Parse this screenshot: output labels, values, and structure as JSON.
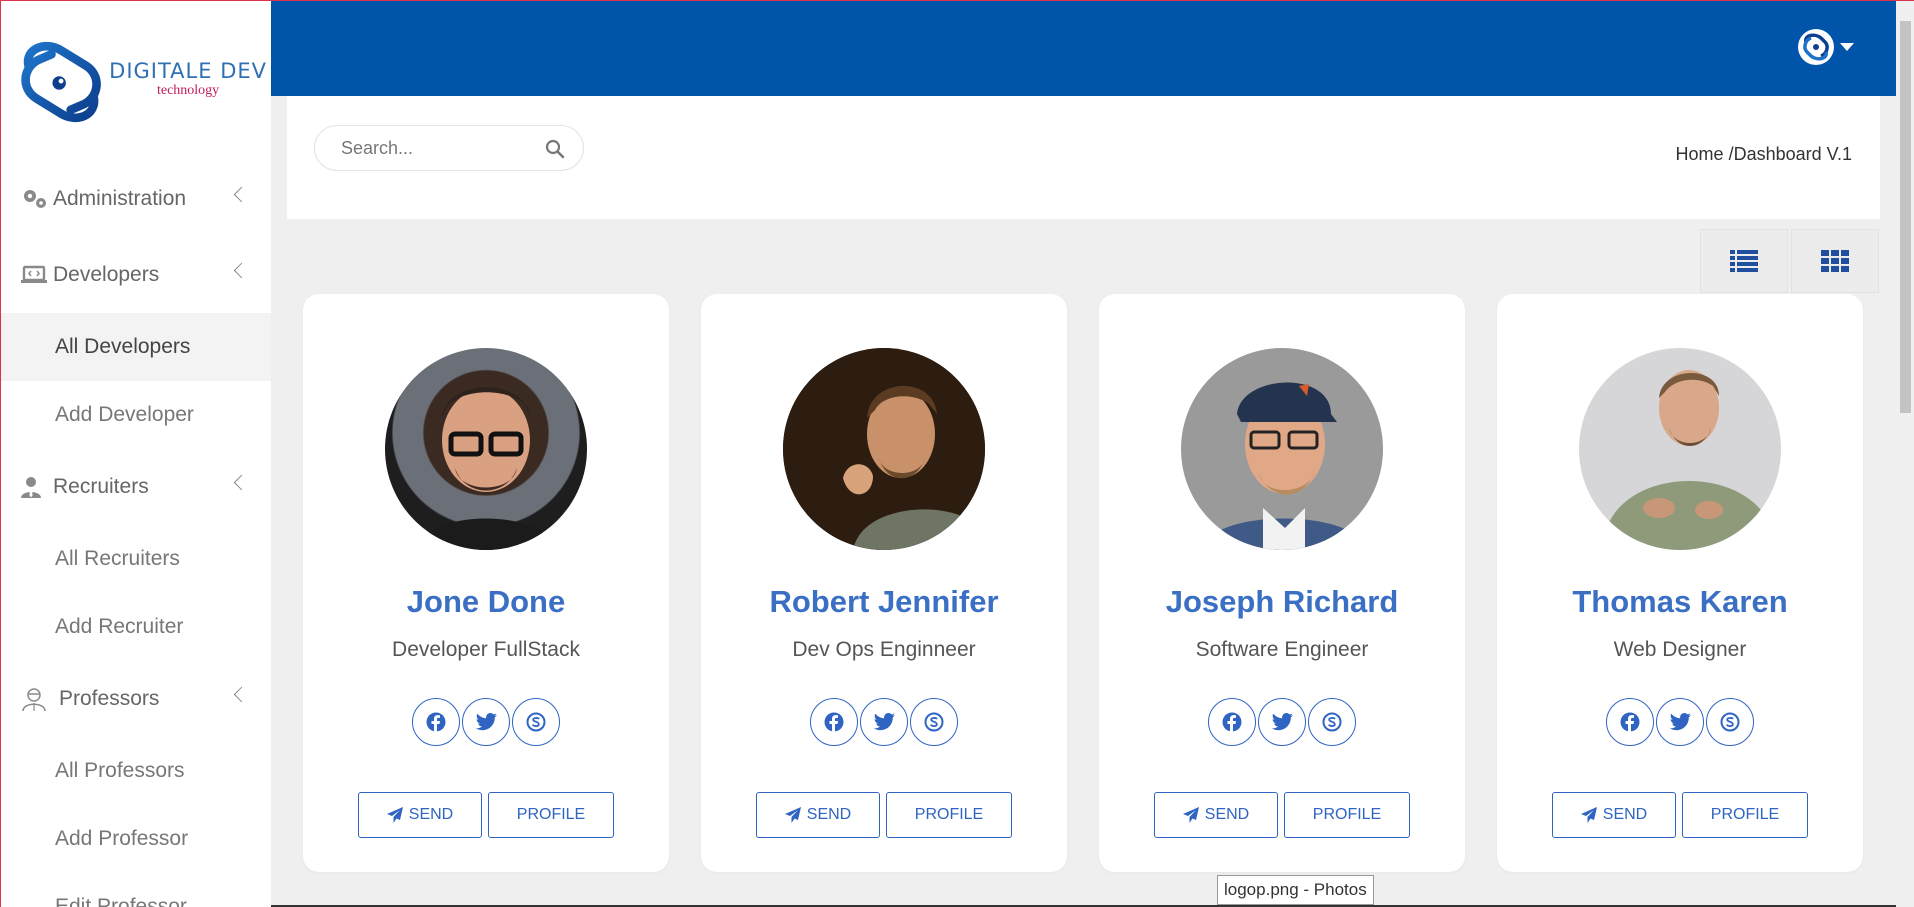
{
  "brand": {
    "title": "DIGITALE DEV",
    "subtitle": "technology"
  },
  "sidebar": {
    "groups": [
      {
        "label": "Administration",
        "icon": "gears-icon"
      },
      {
        "label": "Developers",
        "icon": "laptop-code-icon",
        "items": [
          "All Developers",
          "Add Developer"
        ],
        "active": "All Developers"
      },
      {
        "label": "Recruiters",
        "icon": "user-tie-icon",
        "items": [
          "All Recruiters",
          "Add Recruiter"
        ]
      },
      {
        "label": "Professors",
        "icon": "professor-icon",
        "items": [
          "All Professors",
          "Add Professor",
          "Edit Professor"
        ]
      }
    ]
  },
  "search": {
    "placeholder": "Search..."
  },
  "breadcrumb": "Home /Dashboard V.1",
  "cards": [
    {
      "name": "Jone Done",
      "role": "Developer FullStack",
      "send": "SEND",
      "profile": "PROFILE"
    },
    {
      "name": "Robert Jennifer",
      "role": "Dev Ops Enginneer",
      "send": "SEND",
      "profile": "PROFILE"
    },
    {
      "name": "Joseph Richard",
      "role": "Software Engineer",
      "send": "SEND",
      "profile": "PROFILE"
    },
    {
      "name": "Thomas Karen",
      "role": "Web Designer",
      "send": "SEND",
      "profile": "PROFILE"
    }
  ],
  "tooltip": "logop.png - Photos",
  "colors": {
    "topbar": "#0055aa",
    "accent": "#3a6fc4",
    "button": "#2f64c2"
  }
}
